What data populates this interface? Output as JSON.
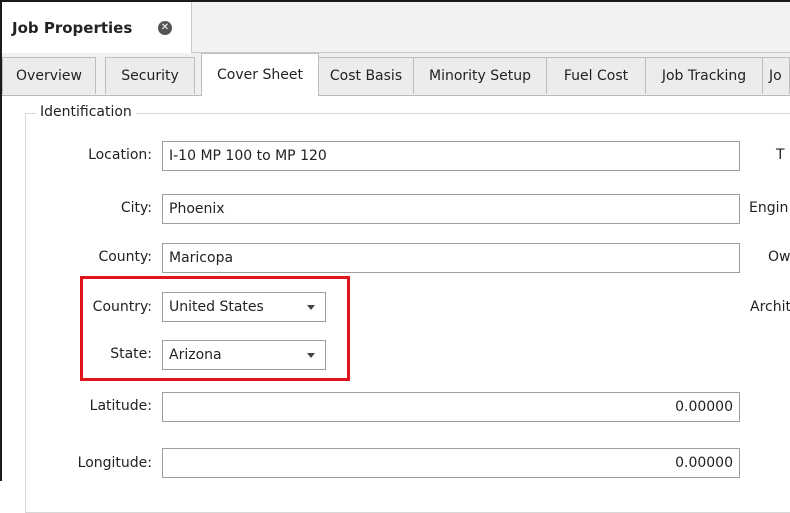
{
  "document_tab": {
    "title": "Job Properties"
  },
  "tabs": [
    {
      "label": "Overview"
    },
    {
      "label": "Security"
    },
    {
      "label": "Cover Sheet"
    },
    {
      "label": "Cost Basis"
    },
    {
      "label": "Minority Setup"
    },
    {
      "label": "Fuel Cost"
    },
    {
      "label": "Job Tracking"
    },
    {
      "label": "Jo"
    }
  ],
  "identification": {
    "legend": "Identification",
    "location": {
      "label": "Location:",
      "value": "I-10 MP 100 to MP 120"
    },
    "city": {
      "label": "City:",
      "value": "Phoenix"
    },
    "county": {
      "label": "County:",
      "value": "Maricopa"
    },
    "country": {
      "label": "Country:",
      "value": "United States"
    },
    "state": {
      "label": "State:",
      "value": "Arizona"
    },
    "latitude": {
      "label": "Latitude:",
      "value": "0.00000"
    },
    "longitude": {
      "label": "Longitude:",
      "value": "0.00000"
    }
  },
  "right_labels": [
    "T",
    "Engin",
    "Ow",
    "Archit"
  ],
  "colors": {
    "highlight": "#e0141c"
  }
}
